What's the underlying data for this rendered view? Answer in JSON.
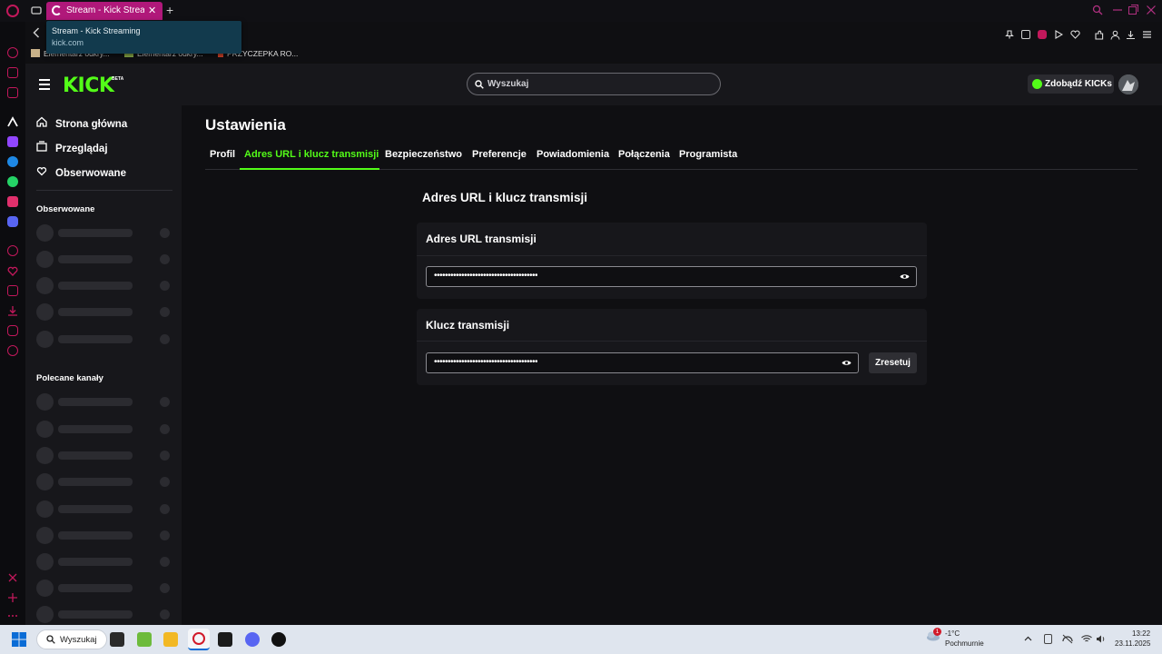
{
  "browser": {
    "tab_title": "Stream - Kick Streaming",
    "tab_close": "✕",
    "new_tab": "+",
    "tooltip_title": "Stream - Kick Streaming",
    "tooltip_url": "kick.com",
    "bookmarks": [
      "Elementarz odkry...",
      "Elementarz odkry...",
      "PRZYCZEPKA RO..."
    ]
  },
  "header": {
    "logo": "KICK",
    "logo_badge": "BETA",
    "search_placeholder": "Wyszukaj",
    "kicks_button": "Zdobądź KICKs"
  },
  "sidebar": {
    "nav": [
      {
        "label": "Strona główna",
        "icon": "home-icon"
      },
      {
        "label": "Przeglądaj",
        "icon": "browse-icon"
      },
      {
        "label": "Obserwowane",
        "icon": "heart-icon"
      }
    ],
    "followed_heading": "Obserwowane",
    "recommended_heading": "Polecane kanały"
  },
  "settings": {
    "title": "Ustawienia",
    "tabs": [
      "Profil",
      "Adres URL i klucz transmisji",
      "Bezpieczeństwo",
      "Preferencje",
      "Powiadomienia",
      "Połączenia",
      "Programista"
    ],
    "active_tab": "Adres URL i klucz transmisji",
    "section_title": "Adres URL i klucz transmisji",
    "url_card": {
      "heading": "Adres URL transmisji",
      "masked_value": "••••••••••••••••••••••••••••••••••••••"
    },
    "key_card": {
      "heading": "Klucz transmisji",
      "masked_value": "••••••••••••••••••••••••••••••••••••••",
      "reset_label": "Zresetuj"
    }
  },
  "taskbar": {
    "search_label": "Wyszukaj",
    "weather_temp": "-1°C",
    "weather_desc": "Pochmurnie",
    "weather_badge": "1",
    "time": "13:22",
    "date": "23.11.2025"
  },
  "colors": {
    "accent": "#53fc18",
    "opera_tab": "#b0187a",
    "background": "#0f0f12",
    "panel": "#17171b"
  }
}
